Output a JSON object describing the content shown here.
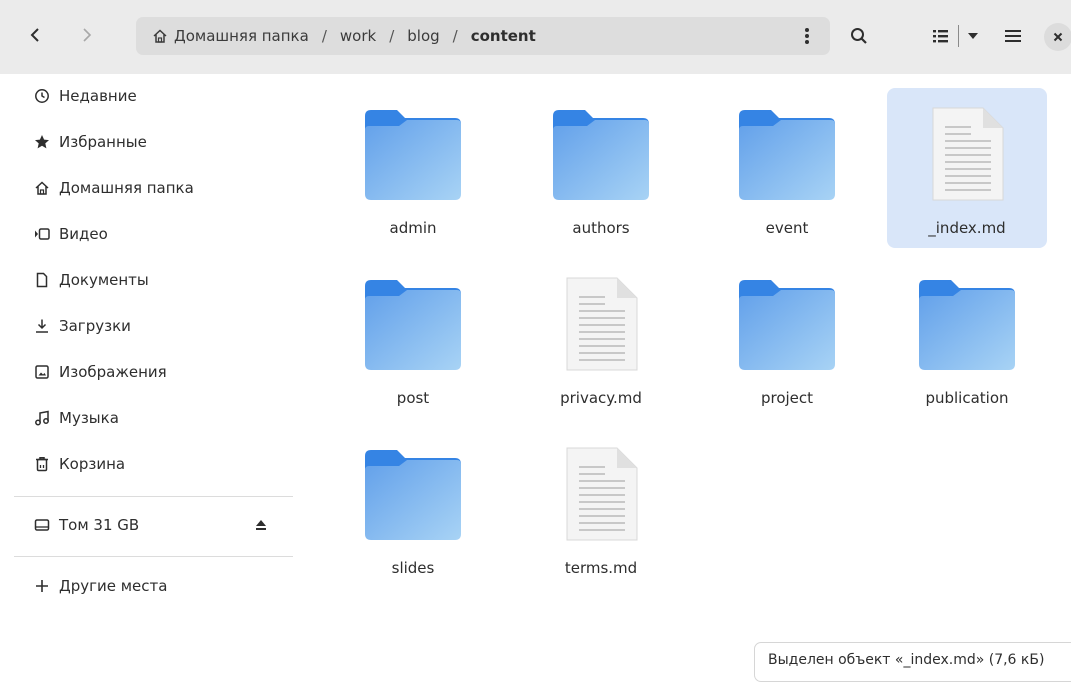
{
  "header": {
    "path": [
      "Домашняя папка",
      "work",
      "blog",
      "content"
    ],
    "path_separator": "/"
  },
  "sidebar": {
    "items": [
      {
        "label": "Недавние",
        "icon": "clock-icon"
      },
      {
        "label": "Избранные",
        "icon": "star-icon"
      },
      {
        "label": "Домашняя папка",
        "icon": "home-icon"
      },
      {
        "label": "Видео",
        "icon": "video-icon"
      },
      {
        "label": "Документы",
        "icon": "document-icon"
      },
      {
        "label": "Загрузки",
        "icon": "download-icon"
      },
      {
        "label": "Изображения",
        "icon": "image-icon"
      },
      {
        "label": "Музыка",
        "icon": "music-icon"
      },
      {
        "label": "Корзина",
        "icon": "trash-icon"
      }
    ],
    "volume": {
      "label": "Том 31 GB",
      "icon": "drive-icon"
    },
    "other": {
      "label": "Другие места",
      "icon": "plus-icon"
    }
  },
  "files": [
    {
      "name": "admin",
      "type": "folder",
      "selected": false
    },
    {
      "name": "authors",
      "type": "folder",
      "selected": false
    },
    {
      "name": "event",
      "type": "folder",
      "selected": false
    },
    {
      "name": "_index.md",
      "type": "document",
      "selected": true
    },
    {
      "name": "post",
      "type": "folder",
      "selected": false
    },
    {
      "name": "privacy.md",
      "type": "document",
      "selected": false
    },
    {
      "name": "project",
      "type": "folder",
      "selected": false
    },
    {
      "name": "publication",
      "type": "folder",
      "selected": false
    },
    {
      "name": "slides",
      "type": "folder",
      "selected": false
    },
    {
      "name": "terms.md",
      "type": "document",
      "selected": false
    }
  ],
  "status": {
    "text": "Выделен объект «_index.md» (7,6 кБ)"
  },
  "colors": {
    "folder_tab": "#3584e4",
    "folder_body_top": "#62a0ea",
    "folder_body_bottom": "#a8d3f5",
    "selection": "#d9e6f9"
  }
}
